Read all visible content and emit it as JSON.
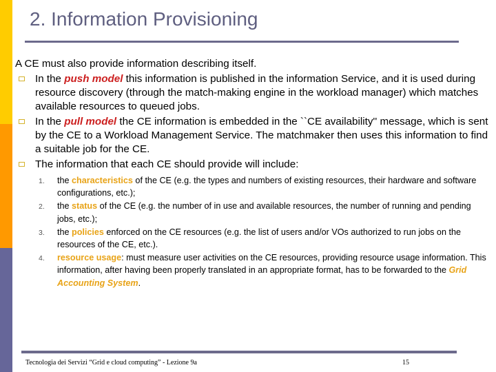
{
  "slide": {
    "title": "2. Information Provisioning",
    "intro": "A CE must also provide information  describing itself.",
    "bullets": [
      {
        "icon": "square-bullet-icon",
        "pre": "In the ",
        "emphasis": "push model",
        "post": " this information is published in the information Service, and it is used during resource discovery (through the match-making engine in the workload manager) which matches available resources to queued jobs."
      },
      {
        "icon": "square-bullet-icon",
        "pre": "In the ",
        "emphasis": "pull model",
        "post": " the CE information is embedded in the ``CE availability'' message, which is sent by the CE to a Workload Management Service. The matchmaker then uses this information to find a suitable job for the CE."
      },
      {
        "icon": "square-bullet-icon",
        "text": "The information that each CE should provide will include:"
      }
    ],
    "numbered": [
      {
        "num": "1.",
        "pre": "the ",
        "highlight": "characteristics",
        "post": " of the CE (e.g. the types and numbers of existing  resources, their hardware and software configurations, etc.);"
      },
      {
        "num": "2.",
        "pre": "the ",
        "highlight": "status",
        "post": " of the CE (e.g. the number of in use and available resources, the number of running and pending jobs, etc.);"
      },
      {
        "num": "3.",
        "pre": "the ",
        "highlight": "policies",
        "post": " enforced on the CE resources (e.g. the list of users and/or VOs authorized to run jobs on the resources of the CE, etc.)."
      },
      {
        "num": "4.",
        "pre": " ",
        "highlight": "resource usage",
        "post": ": must measure user activities on the CE resources, providing resource usage information. This information, after having been properly translated in an appropriate format, has to be forwarded to the ",
        "highlight2": "Grid Accounting System",
        "post2": "."
      }
    ]
  },
  "footer": {
    "text": "Tecnologia dei Servizi “Grid e cloud computing” - Lezione 9a",
    "page_number": "15"
  },
  "colors": {
    "sidebar_yellow": "#ffcc00",
    "sidebar_orange": "#ff9900",
    "sidebar_purple": "#666699",
    "title": "#5f5f80",
    "rule": "#6c6a8c",
    "emphasis_red": "#cc1f1f",
    "highlight_orange": "#e8a317",
    "bullet_marker": "#d4b22a"
  }
}
